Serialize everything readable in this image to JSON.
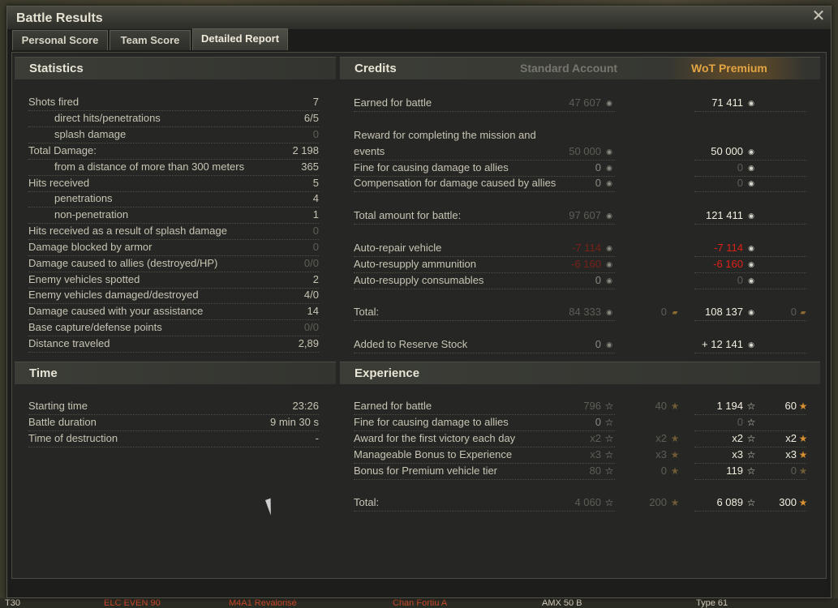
{
  "window": {
    "title": "Battle Results",
    "close_symbol": "✕"
  },
  "tabs": [
    "Personal Score",
    "Team Score",
    "Detailed Report"
  ],
  "active_tab": "Detailed Report",
  "statistics": {
    "heading": "Statistics",
    "rows": [
      {
        "label": "Shots fired",
        "value": "7"
      },
      {
        "label": "direct hits/penetrations",
        "value": "6/5"
      },
      {
        "label": "splash damage",
        "value": "0"
      },
      {
        "label": "Total Damage:",
        "value": "2 198"
      },
      {
        "label": "from a distance of more than 300 meters",
        "value": "365"
      },
      {
        "label": "Hits received",
        "value": "5"
      },
      {
        "label": "penetrations",
        "value": "4"
      },
      {
        "label": "non-penetration",
        "value": "1"
      },
      {
        "label": "Hits received as a result of splash damage",
        "value": "0"
      },
      {
        "label": "Damage blocked by armor",
        "value": "0"
      },
      {
        "label": "Damage caused to allies (destroyed/HP)",
        "value": "0/0"
      },
      {
        "label": "Enemy vehicles spotted",
        "value": "2"
      },
      {
        "label": "Enemy vehicles damaged/destroyed",
        "value": "4/0"
      },
      {
        "label": "Damage caused with your assistance",
        "value": "14"
      },
      {
        "label": "Base capture/defense points",
        "value": "0/0"
      },
      {
        "label": "Distance traveled",
        "value": "2,89"
      }
    ]
  },
  "time": {
    "heading": "Time",
    "rows": [
      {
        "label": "Starting time",
        "value": "23:26"
      },
      {
        "label": "Battle duration",
        "value": "9 min 30 s"
      },
      {
        "label": "Time of destruction",
        "value": "-"
      }
    ]
  },
  "credits": {
    "heading": "Credits",
    "col_standard": "Standard Account",
    "col_premium": "WoT Premium",
    "rows": [
      {
        "label": "Earned for battle",
        "std": "47 607",
        "prem": "71 411"
      },
      {
        "label": "Reward for completing the mission and",
        "label2": "events",
        "std": "50 000",
        "prem": "50 000"
      },
      {
        "label": "Fine for causing damage to allies",
        "std": "0",
        "prem": "0"
      },
      {
        "label": "Compensation for damage caused by allies",
        "std": "0",
        "prem": "0"
      },
      {
        "label": "Total amount for battle:",
        "std": "97 607",
        "prem": "121 411"
      },
      {
        "label": "Auto-repair vehicle",
        "std": "-7 114",
        "prem": "-7 114"
      },
      {
        "label": "Auto-resupply ammunition",
        "std": "-6 160",
        "prem": "-6 160"
      },
      {
        "label": "Auto-resupply consumables",
        "std": "0",
        "prem": "0"
      },
      {
        "label": "Total:",
        "std": "84 333",
        "std_gold": "0",
        "prem": "108 137",
        "prem_gold": "0"
      },
      {
        "label": "Added to Reserve Stock",
        "std": "0",
        "prem": "+ 12 141"
      }
    ]
  },
  "experience": {
    "heading": "Experience",
    "rows": [
      {
        "label": "Earned for battle",
        "std": "796",
        "std_free": "40",
        "prem": "1 194",
        "prem_free": "60"
      },
      {
        "label": "Fine for causing damage to allies",
        "std": "0",
        "prem": "0"
      },
      {
        "label": "Award for the first victory each day",
        "std": "x2",
        "std_free": "x2",
        "prem": "x2",
        "prem_free": "x2"
      },
      {
        "label": "Manageable Bonus to Experience",
        "std": "x3",
        "std_free": "x3",
        "prem": "x3",
        "prem_free": "x3"
      },
      {
        "label": "Bonus for Premium vehicle tier",
        "std": "80",
        "std_free": "0",
        "prem": "119",
        "prem_free": "0"
      },
      {
        "label": "Total:",
        "std": "4 060",
        "std_free": "200",
        "prem": "6 089",
        "prem_free": "300"
      }
    ]
  },
  "background_names": [
    "ELC EVEN 90",
    "M4A1 Revalorisé",
    "Chan Fortiu A",
    "AMX 50 B",
    "Type 61"
  ],
  "icons": {
    "credit": "credit-coin-icon",
    "xp": "xp-star-icon",
    "free_xp": "free-xp-star-icon",
    "gold": "gold-icon",
    "cursor": "mouse-cursor-icon"
  }
}
